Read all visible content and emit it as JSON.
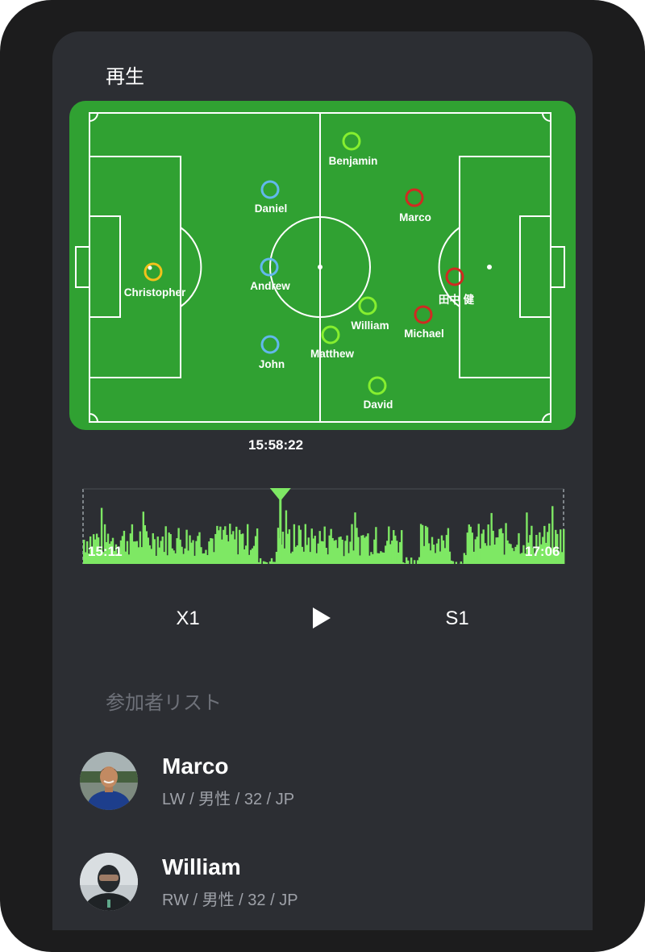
{
  "screen_title": "再生",
  "field": {
    "players": [
      {
        "name": "Benjamin",
        "team": "green"
      },
      {
        "name": "Daniel",
        "team": "blue"
      },
      {
        "name": "Marco",
        "team": "red"
      },
      {
        "name": "Christopher",
        "team": "yellow"
      },
      {
        "name": "Andrew",
        "team": "blue"
      },
      {
        "name": "田中 健",
        "team": "red"
      },
      {
        "name": "William",
        "team": "green"
      },
      {
        "name": "Michael",
        "team": "red"
      },
      {
        "name": "Matthew",
        "team": "green"
      },
      {
        "name": "John",
        "team": "blue"
      },
      {
        "name": "David",
        "team": "green"
      }
    ],
    "colors": {
      "pitch": "#30a132",
      "lines": "#ffffff",
      "green": "#86ef2f",
      "blue": "#62b8ec",
      "red": "#d02a22",
      "yellow": "#f2c21b"
    }
  },
  "timeline": {
    "start": "15:11",
    "end": "17:06",
    "cursor": "15:58:22",
    "cursor_fraction": 0.41,
    "bar_color": "#7ee864"
  },
  "controls": {
    "speed_label": "X1",
    "play_icon": "play-icon",
    "step_label": "S1"
  },
  "participants_title": "参加者リスト",
  "participants": [
    {
      "name": "Marco",
      "info": "LW / 男性 / 32 / JP"
    },
    {
      "name": "William",
      "info": "RW / 男性 / 32 / JP"
    }
  ]
}
